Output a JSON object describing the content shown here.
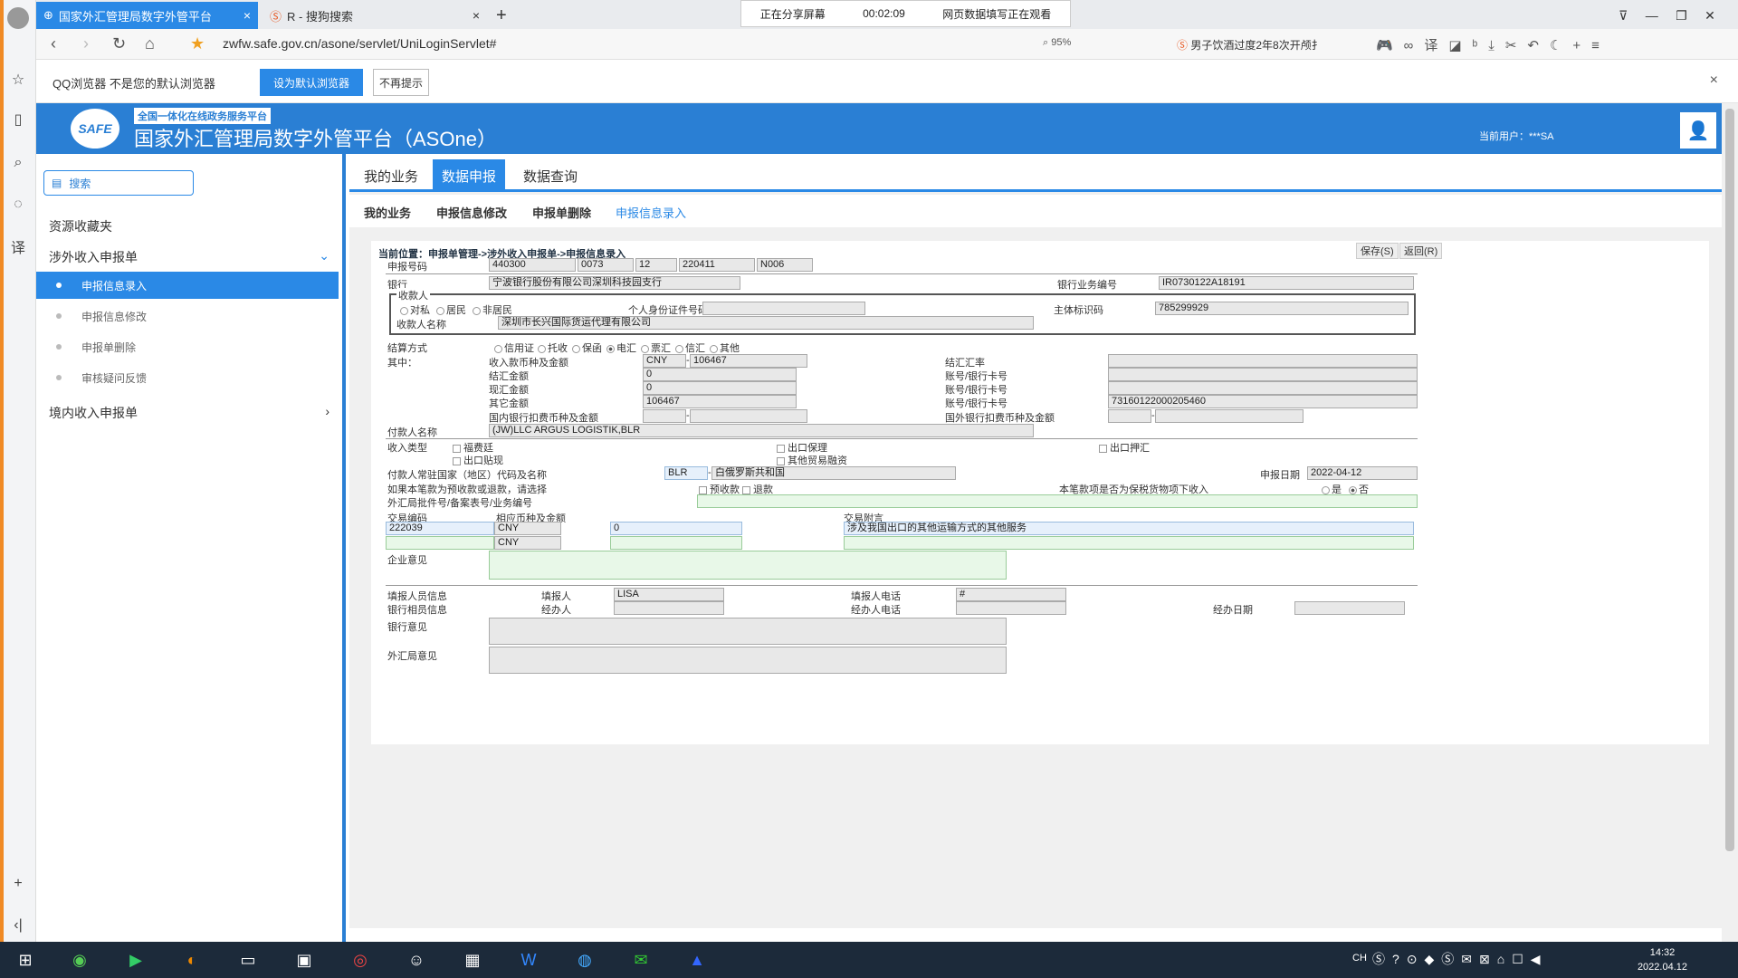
{
  "browser": {
    "tabs": [
      {
        "label": "国家外汇管理局数字外管平台",
        "active": true
      },
      {
        "label": "R - 搜狗搜索",
        "active": false
      }
    ],
    "share": {
      "status": "正在分享屏幕",
      "time": "00:02:09",
      "note": "网页数据填写正在观看"
    },
    "url": "zwfw.safe.gov.cn/asone/servlet/UniLoginServlet#",
    "zoom": "95%",
    "news": "男子饮酒过度2年8次开颅扌",
    "infobar": {
      "message": "QQ浏览器 不是您的默认浏览器",
      "set_default": "设为默认浏览器",
      "no_remind": "不再提示"
    }
  },
  "app": {
    "platform_subtitle": "全国一体化在线政务服务平台",
    "platform_title": "国家外汇管理局数字外管平台（ASOne）",
    "current_user": "当前用户：***SA",
    "logo_text": "SAFE"
  },
  "sidebar": {
    "search": "搜索",
    "favorites": "资源收藏夹",
    "group1": "涉外收入申报单",
    "items": [
      "申报信息录入",
      "申报信息修改",
      "申报单删除",
      "审核疑问反馈"
    ],
    "group2": "境内收入申报单"
  },
  "nav": {
    "tabs": [
      "我的业务",
      "数据申报",
      "数据查询"
    ]
  },
  "subtabs": [
    "我的业务",
    "申报信息修改",
    "申报单删除",
    "申报信息录入"
  ],
  "form": {
    "location": "当前位置：申报单管理->涉外收入申报单->申报信息录入",
    "save": "保存(S)",
    "back": "返回(R)",
    "report_no_label": "申报号码",
    "report_no": [
      "440300",
      "0073",
      "12",
      "220411",
      "N006"
    ],
    "bank_label": "银行",
    "bank": "宁波银行股份有限公司深圳科技园支行",
    "bank_biz_no_label": "银行业务编号",
    "bank_biz_no": "IR0730122A18191",
    "payee_legend": "收款人",
    "payee_types": [
      "对私",
      "居民",
      "非居民"
    ],
    "id_no_label": "个人身份证件号码",
    "entity_code_label": "主体标识码",
    "entity_code": "785299929",
    "payee_name_label": "收款人名称",
    "payee_name": "深圳市长兴国际货运代理有限公司",
    "settle_label": "结算方式",
    "settle_methods": [
      "信用证",
      "托收",
      "保函",
      "电汇",
      "票汇",
      "信汇",
      "其他"
    ],
    "among_label": "其中：",
    "currency_amount_label": "收入款币种及金额",
    "currency": "CNY",
    "amount": "106467",
    "fx_rate_label": "结汇汇率",
    "settled_label": "结汇金额",
    "settled": "0",
    "spot_label": "现汇金额",
    "spot": "0",
    "other_label": "其它金额",
    "other": "106467",
    "account_label": "账号/银行卡号",
    "account": "73160122000205460",
    "domestic_fee_label": "国内银行扣费币种及金额",
    "foreign_fee_label": "国外银行扣费币种及金额",
    "payer_name_label": "付款人名称",
    "payer_name": "(JW)LLC ARGUS LOGISTIK,BLR",
    "income_type_label": "收入类型",
    "income_types": [
      "福费廷",
      "出口保理",
      "出口押汇",
      "出口贴现",
      "其他贸易融资"
    ],
    "payer_country_label": "付款人常驻国家（地区）代码及名称",
    "country_code": "BLR",
    "country_name": "白俄罗斯共和国",
    "report_date_label": "申报日期",
    "report_date": "2022-04-12",
    "prepay_label": "如果本笔款为预收款或退款，请选择",
    "prepay_opts": [
      "预收款",
      "退款"
    ],
    "bonded_label": "本笔款项是否为保税货物项下收入",
    "bonded_opts": [
      "是",
      "否"
    ],
    "approval_label": "外汇局批件号/备案表号/业务编号",
    "txn_code_label": "交易编码",
    "txn_code": "222039",
    "rel_currency_label": "相应币种及金额",
    "rel_currency1": "CNY",
    "rel_amount1": "0",
    "rel_currency2": "CNY",
    "txn_note_label": "交易附言",
    "txn_note": "涉及我国出口的其他运输方式的其他服务",
    "opinion_label": "企业意见",
    "filler_info_label": "填报人员信息",
    "filler_label": "填报人",
    "filler": "LISA",
    "filler_phone_label": "填报人电话",
    "filler_phone": "#",
    "bank_staff_label": "银行相员信息",
    "handler_label": "经办人",
    "handler_phone_label": "经办人电话",
    "handle_date_label": "经办日期",
    "bank_opinion_label": "银行意见",
    "fx_opinion_label": "外汇局意见"
  },
  "taskbar": {
    "ime": "CH",
    "time": "14:32",
    "date": "2022.04.12"
  }
}
